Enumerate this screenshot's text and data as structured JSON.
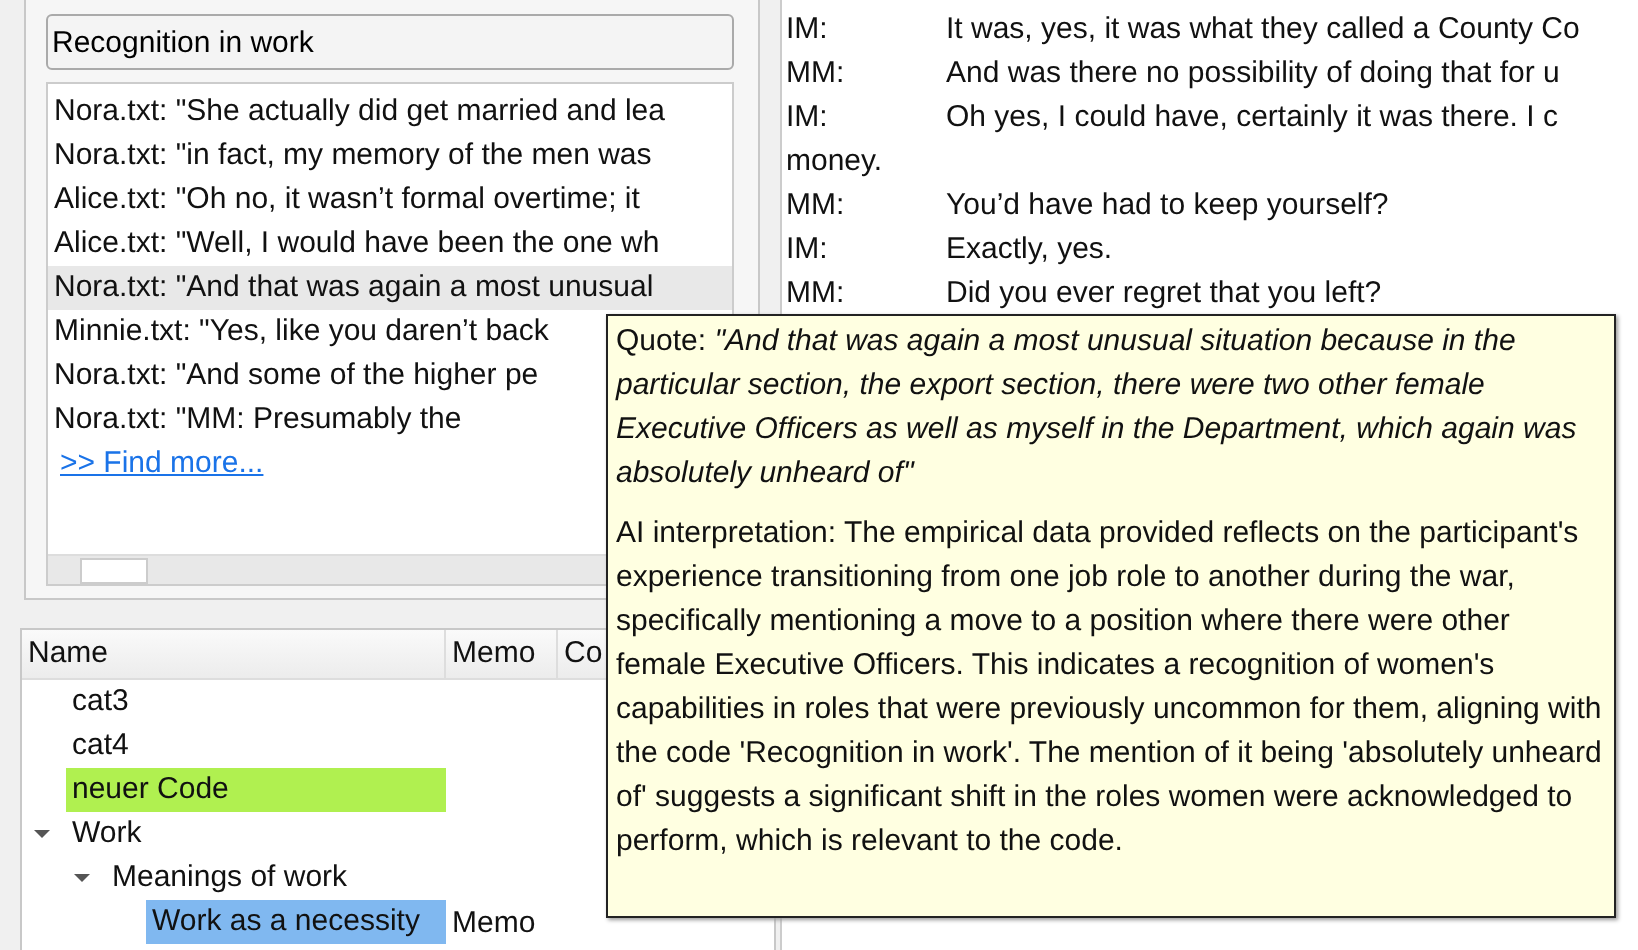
{
  "search": {
    "value": "Recognition in work"
  },
  "results": [
    {
      "text": "Nora.txt: \"She actually did get married and lea",
      "selected": false
    },
    {
      "text": "Nora.txt: \"in fact, my memory of the men was",
      "selected": false
    },
    {
      "text": "Alice.txt: \"Oh no, it wasn’t formal overtime; it",
      "selected": false
    },
    {
      "text": "Alice.txt: \"Well, I would have been the one wh",
      "selected": false
    },
    {
      "text": "Nora.txt: \"And that was again a most unusual",
      "selected": true
    },
    {
      "text": "Minnie.txt: \"Yes, like you daren’t back",
      "selected": false
    },
    {
      "text": "Nora.txt: \"And some of the higher pe",
      "selected": false
    },
    {
      "text": "Nora.txt: \"MM:            Presumably the",
      "selected": false
    }
  ],
  "find_more": ">> Find more...",
  "tree": {
    "columns": [
      "Name",
      "Memo",
      "Co"
    ],
    "items": [
      {
        "name": "cat3"
      },
      {
        "name": "cat4"
      },
      {
        "name": "neuer Code",
        "color": "#b0f050"
      },
      {
        "name": "Work",
        "expanded": true,
        "children": [
          {
            "name": "Meanings of work",
            "expanded": true,
            "children": [
              {
                "name": "Work as a necessity",
                "color": "#80b8f0",
                "memo": "Memo"
              }
            ]
          }
        ]
      }
    ]
  },
  "transcript": [
    {
      "speaker": "IM:",
      "text": "It was, yes, it was what they called a County Co"
    },
    {
      "speaker": "MM:",
      "text": "And was there no possibility of doing that for u"
    },
    {
      "speaker": "IM:",
      "text": "Oh yes, I could have, certainly it was there.  I c"
    },
    {
      "text": "money."
    },
    {
      "speaker": "MM:",
      "text": "You’d have had to keep yourself?"
    },
    {
      "speaker": "IM:",
      "text": "Exactly, yes."
    },
    {
      "speaker": "MM:",
      "text": "Did you ever regret that you left?"
    }
  ],
  "tooltip": {
    "quote_label": "Quote:",
    "quote": "\"And that was again a most unusual situation because in the particular section, the export section, there were two other female Executive Officers as well as myself in the Department, which again was absolutely unheard of\"",
    "interpretation": "AI interpretation: The empirical data provided reflects on the participant's experience transitioning from one job role to another during the war, specifically mentioning a move to a position where there were other female Executive Officers. This indicates a recognition of women's capabilities in roles that were previously uncommon for them, aligning with the code 'Recognition in work'. The mention of it being 'absolutely unheard of' suggests a significant shift in the roles women were acknowledged to perform, which is relevant to the code."
  }
}
